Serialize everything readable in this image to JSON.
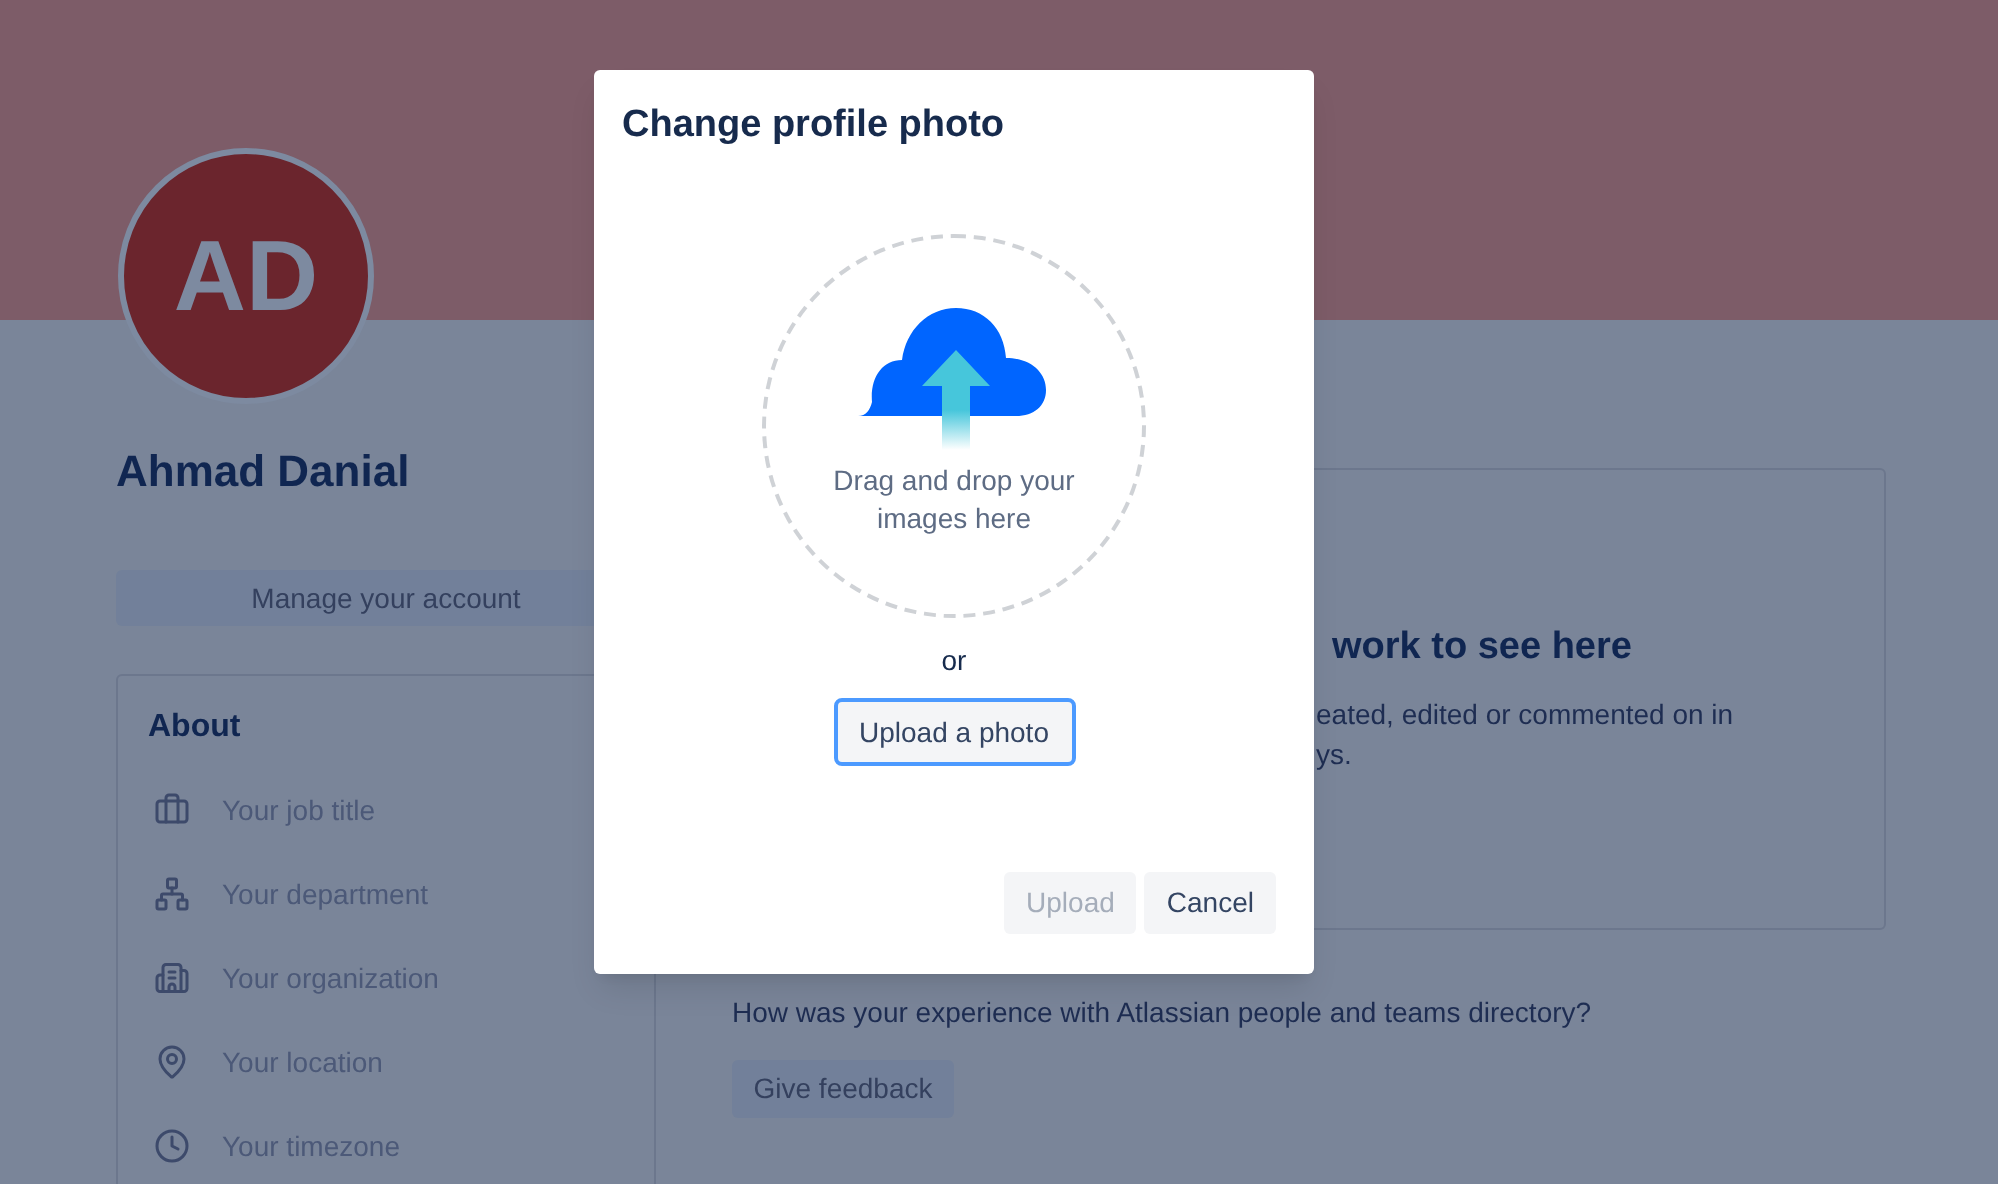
{
  "profile": {
    "avatar_initials": "AD",
    "name": "Ahmad Danial",
    "manage_button": "Manage your account"
  },
  "about": {
    "title": "About",
    "items": [
      {
        "kind": "job",
        "label": "Your job title"
      },
      {
        "kind": "department",
        "label": "Your department"
      },
      {
        "kind": "organization",
        "label": "Your organization"
      },
      {
        "kind": "location",
        "label": "Your location"
      },
      {
        "kind": "timezone",
        "label": "Your timezone"
      }
    ]
  },
  "work_card": {
    "heading": "work to see here",
    "lines": [
      "eated, edited or commented on in",
      "ys."
    ]
  },
  "feedback": {
    "question": "How was your experience with Atlassian people and teams directory?",
    "button": "Give feedback"
  },
  "dialog": {
    "title": "Change profile photo",
    "dropzone_text": "Drag and drop your images here",
    "or": "or",
    "upload_photo_button": "Upload a photo",
    "buttons": [
      {
        "label": "Upload",
        "disabled": true
      },
      {
        "label": "Cancel",
        "disabled": false
      }
    ]
  }
}
